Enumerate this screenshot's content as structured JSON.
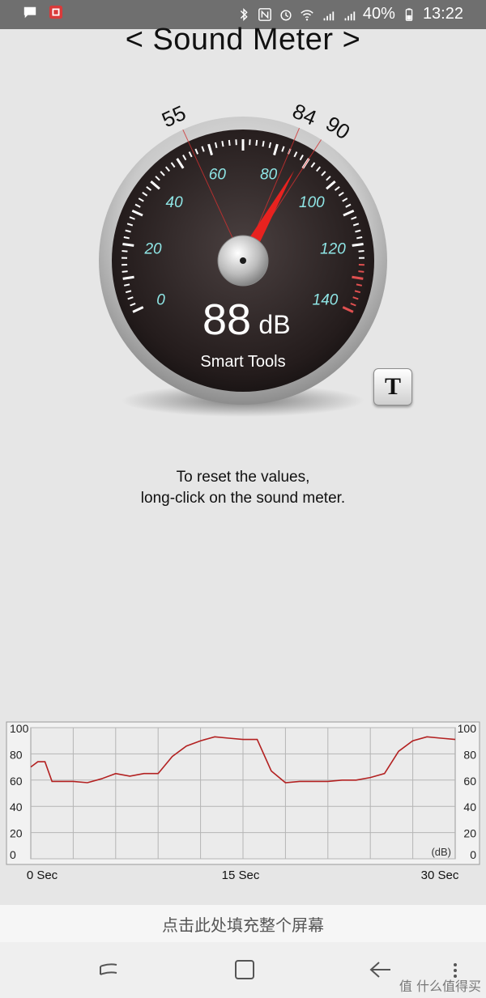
{
  "status_bar": {
    "battery": "40%",
    "time": "13:22",
    "icons": [
      "message-icon",
      "app-notification-icon",
      "bluetooth-icon",
      "nfc-icon",
      "alarm-icon",
      "wifi-icon",
      "signal-4g-icon",
      "signal-icon",
      "battery-icon"
    ]
  },
  "header": {
    "prev_arrow": "<",
    "title": "Sound Meter",
    "next_arrow": ">"
  },
  "gauge": {
    "value_number": "88",
    "value_unit": "dB",
    "brand": "Smart Tools",
    "scale_min": 0,
    "scale_max": 140,
    "scale_labels": [
      "0",
      "20",
      "40",
      "60",
      "80",
      "100",
      "120",
      "140"
    ],
    "current_value": 88,
    "min_marker": "55",
    "avg_marker": "84",
    "max_marker": "90",
    "min_value": 55,
    "avg_value": 84,
    "max_value": 90,
    "colors": {
      "face": "#2b2222",
      "scale_text": "#8fe6e6",
      "needle": "#e8221f",
      "ticks": "#ffffff",
      "danger_ticks": "#e05050"
    }
  },
  "t_button": {
    "label": "T"
  },
  "hint": {
    "line1": "To reset the values,",
    "line2": "long-click on the sound meter."
  },
  "chart_data": {
    "type": "line",
    "x_labels": [
      "0 Sec",
      "15 Sec",
      "30 Sec"
    ],
    "xlim": [
      0,
      30
    ],
    "ylim": [
      0,
      100
    ],
    "y_ticks": [
      "0",
      "20",
      "40",
      "60",
      "80",
      "100"
    ],
    "unit_label": "(dB)",
    "grid": true,
    "line_color": "#b32121",
    "series": [
      {
        "x": [
          0,
          0.5,
          1,
          1.5,
          2,
          3,
          4,
          5,
          6,
          7,
          8,
          9,
          10,
          11,
          12,
          13,
          14,
          15,
          16,
          17,
          18,
          19,
          20,
          21,
          22,
          23,
          24,
          25,
          26,
          27,
          28,
          29,
          30
        ],
        "values": [
          70,
          74,
          74,
          59,
          59,
          59,
          58,
          61,
          65,
          63,
          65,
          65,
          78,
          86,
          90,
          93,
          92,
          91,
          91,
          67,
          58,
          59,
          59,
          59,
          60,
          60,
          62,
          65,
          82,
          90,
          93,
          92,
          91
        ]
      }
    ]
  },
  "fill_screen_bar": {
    "label": "点击此处填充整个屏幕"
  },
  "nav_bar": {
    "icons": [
      "recents-icon",
      "home-icon",
      "back-icon",
      "more-icon"
    ]
  },
  "watermark": {
    "text": "值 什么值得买"
  }
}
